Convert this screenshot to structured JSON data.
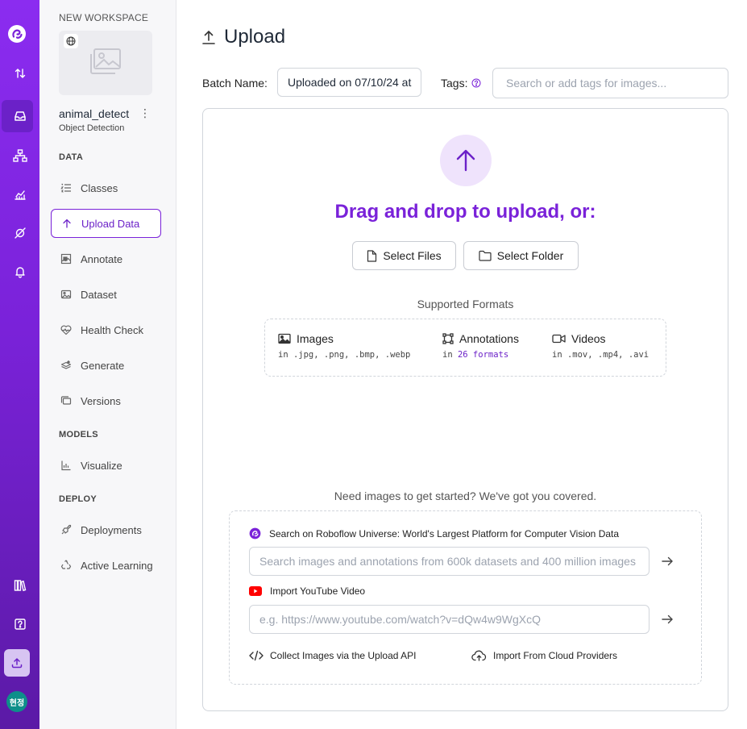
{
  "sidebar": {
    "workspace_label": "NEW WORKSPACE",
    "project_name": "animal_detect",
    "project_type": "Object Detection",
    "sections": {
      "data": "DATA",
      "models": "MODELS",
      "deploy": "DEPLOY"
    },
    "items": {
      "classes": "Classes",
      "upload": "Upload Data",
      "annotate": "Annotate",
      "dataset": "Dataset",
      "health": "Health Check",
      "generate": "Generate",
      "versions": "Versions",
      "visualize": "Visualize",
      "deployments": "Deployments",
      "active_learning": "Active Learning"
    },
    "avatar_initials": "현정"
  },
  "page": {
    "title": "Upload",
    "batch_label": "Batch Name:",
    "batch_value": "Uploaded on 07/10/24 at",
    "tags_label": "Tags:",
    "tags_placeholder": "Search or add tags for images..."
  },
  "upload": {
    "drag_text": "Drag and drop to upload, or:",
    "select_files": "Select Files",
    "select_folder": "Select Folder",
    "formats_title": "Supported Formats",
    "formats": {
      "images": {
        "label": "Images",
        "sub": "in .jpg, .png, .bmp, .webp"
      },
      "annotations": {
        "label": "Annotations",
        "sub_prefix": "in ",
        "sub_highlight": "26 formats"
      },
      "videos": {
        "label": "Videos",
        "sub": "in .mov, .mp4, .avi"
      }
    }
  },
  "resources": {
    "intro": "Need images to get started? We've got you covered.",
    "universe_label": "Search on Roboflow Universe: World's Largest Platform for Computer Vision Data",
    "universe_placeholder": "Search images and annotations from 600k datasets and 400 million images",
    "youtube_label": "Import YouTube Video",
    "youtube_placeholder": "e.g. https://www.youtube.com/watch?v=dQw4w9WgXcQ",
    "api_link": "Collect Images via the Upload API",
    "cloud_link": "Import From Cloud Providers"
  },
  "colors": {
    "accent": "#7a22d9",
    "rail_top": "#8b2cf0",
    "rail_bottom": "#5b1aa6",
    "youtube": "#ff0000"
  },
  "icons": [
    "roboflow-logo",
    "sort-icon",
    "inbox-icon",
    "hierarchy-icon",
    "chart-icon",
    "planet-icon",
    "bell-icon",
    "books-icon",
    "help-icon",
    "upload-icon",
    "globe-icon",
    "image-icon"
  ]
}
